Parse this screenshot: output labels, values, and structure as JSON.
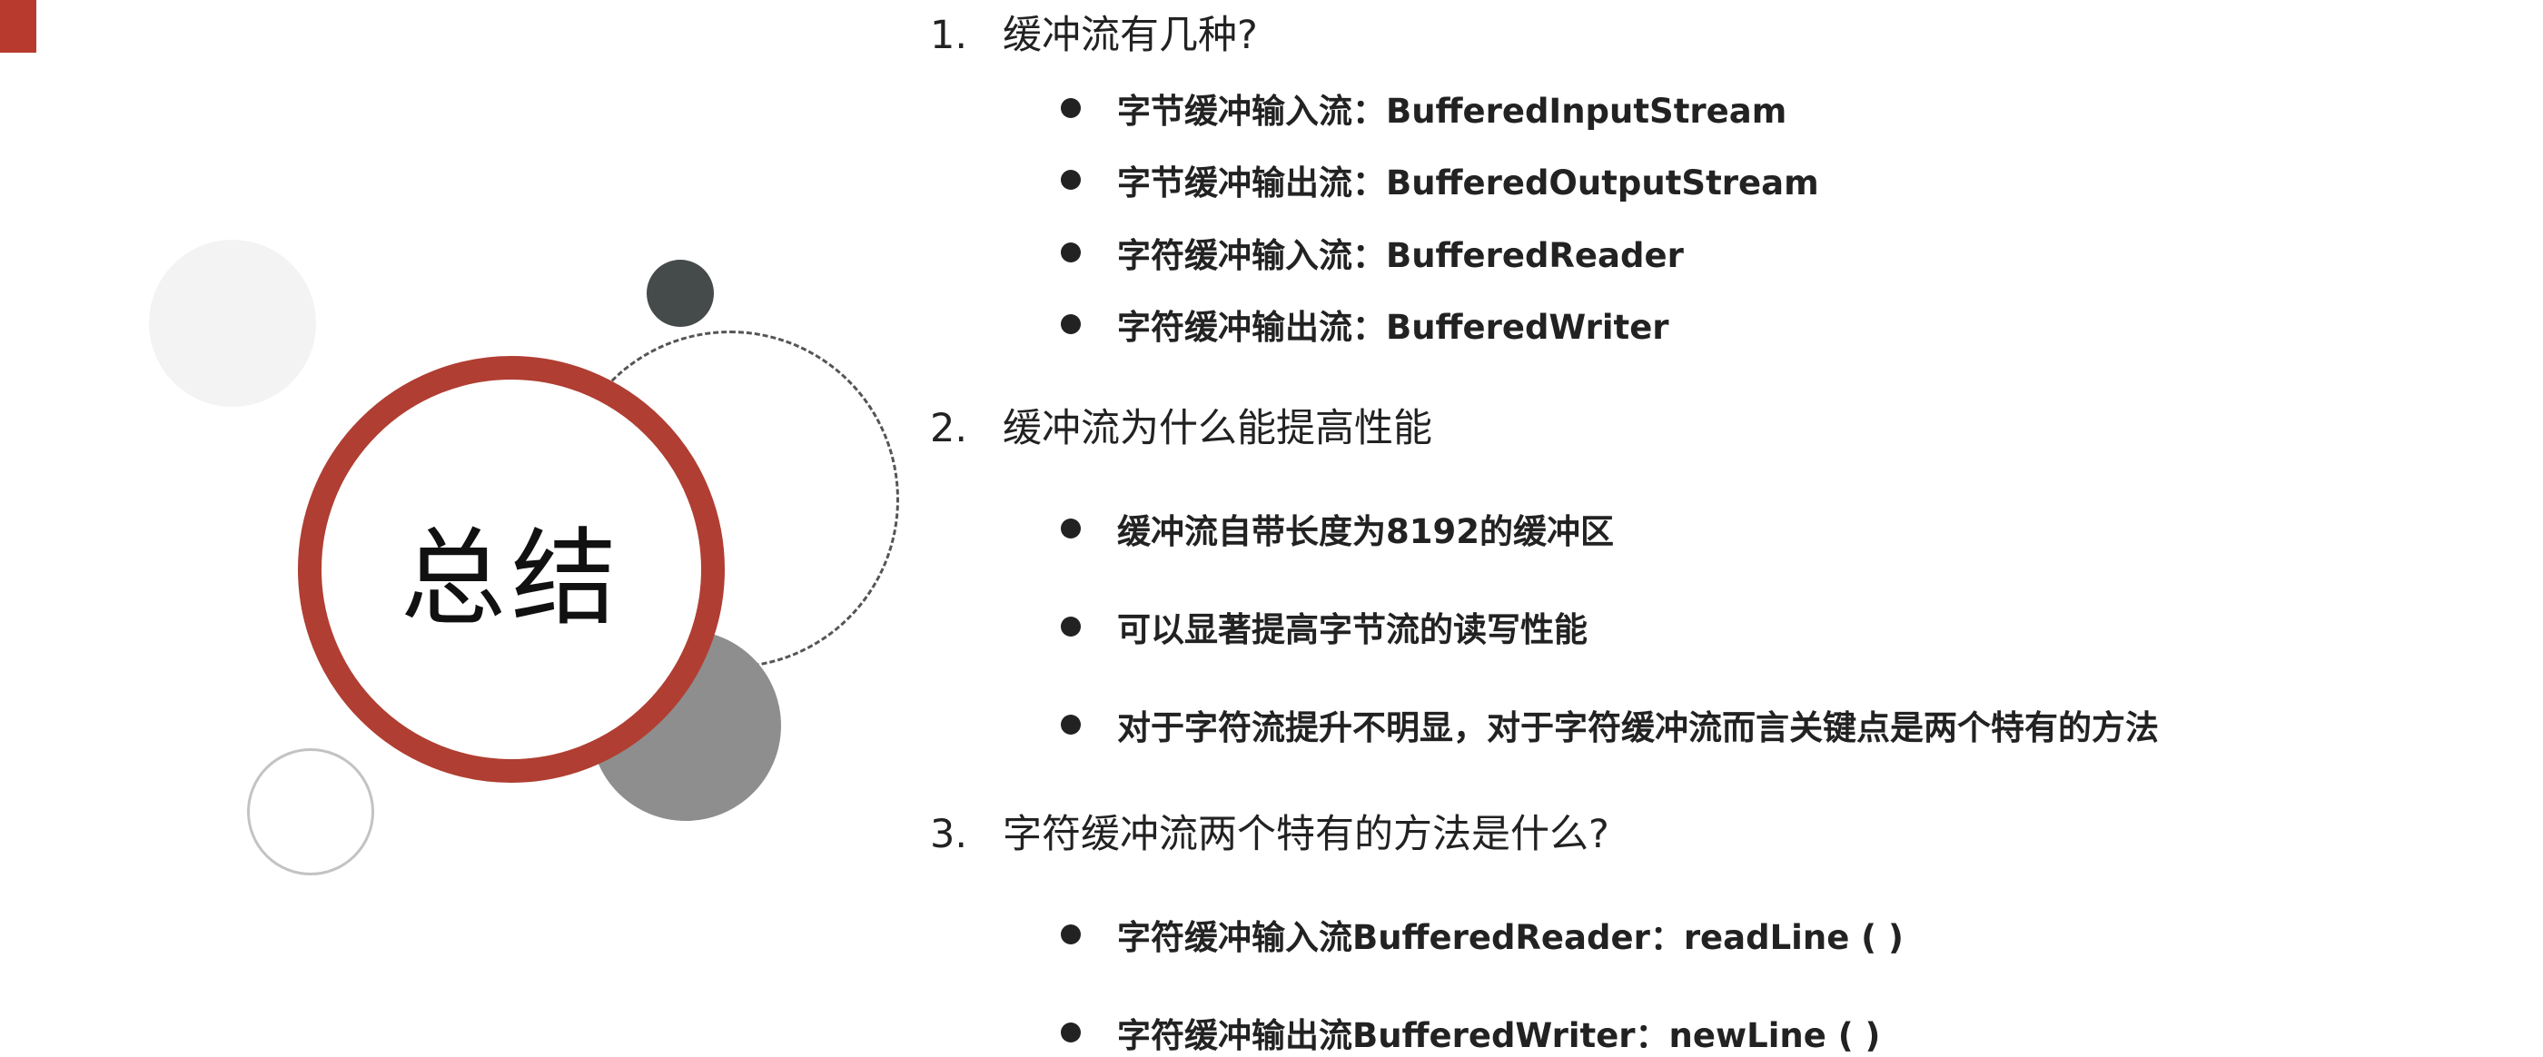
{
  "main_title": "总结",
  "sections": [
    {
      "number": "1.",
      "title": "缓冲流有几种?",
      "items": [
        "字节缓冲输入流：BufferedInputStream",
        "字节缓冲输出流：BufferedOutputStream",
        "字符缓冲输入流：BufferedReader",
        "字符缓冲输出流：BufferedWriter"
      ]
    },
    {
      "number": "2.",
      "title": "缓冲流为什么能提高性能",
      "items": [
        "缓冲流自带长度为8192的缓冲区",
        "可以显著提高字节流的读写性能",
        "对于字符流提升不明显，对于字符缓冲流而言关键点是两个特有的方法"
      ]
    },
    {
      "number": "3.",
      "title": "字符缓冲流两个特有的方法是什么?",
      "items": [
        "字符缓冲输入流BufferedReader：readLine ( )",
        "字符缓冲输出流BufferedWriter：newLine ( )"
      ]
    }
  ],
  "colors": {
    "accent_red": "#b03e32",
    "dark_gray": "#454a4a",
    "mid_gray": "#8e8e8e",
    "light_gray": "#f3f3f3"
  }
}
